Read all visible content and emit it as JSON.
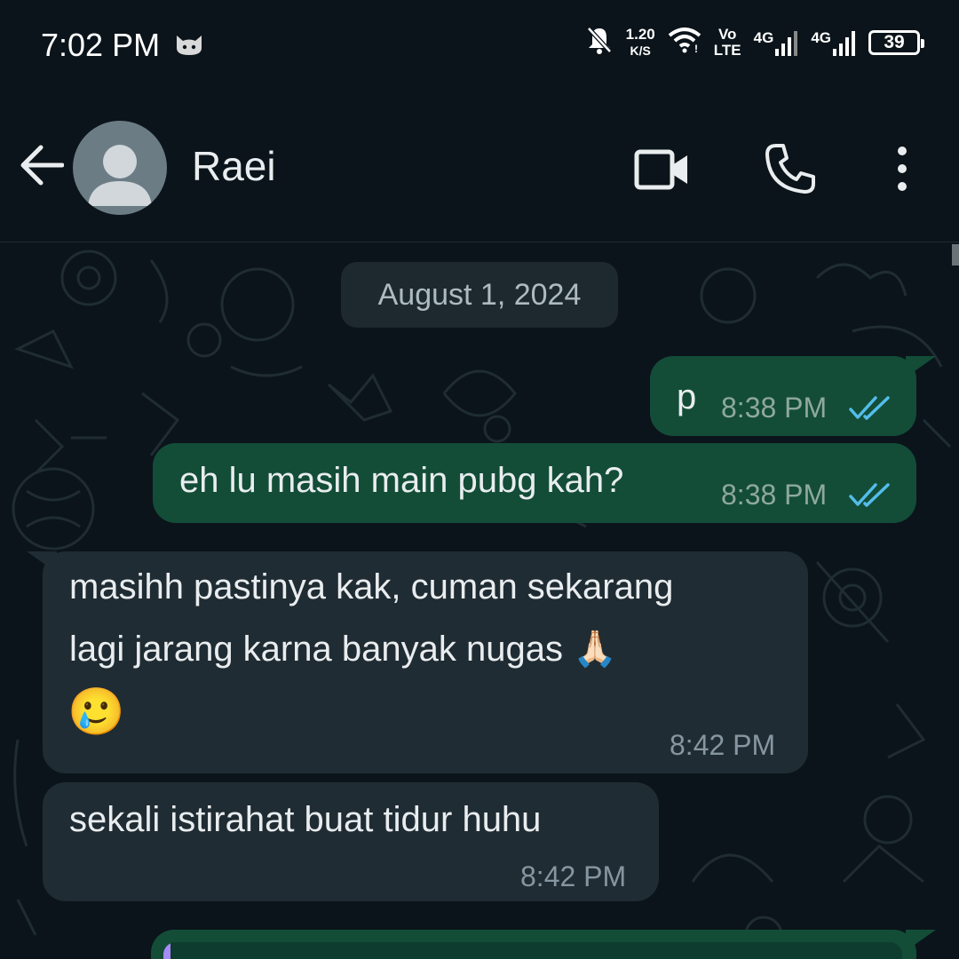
{
  "status_bar": {
    "time": "7:02 PM",
    "speed_value": "1.20",
    "speed_unit": "K/S",
    "volte_top": "Vo",
    "volte_bottom": "LTE",
    "net1": "4G",
    "net2": "4G",
    "battery": "39",
    "icons": [
      "cat-icon",
      "mute-icon",
      "wifi-icon",
      "signal-icon",
      "battery-icon"
    ]
  },
  "header": {
    "contact_name": "Raei",
    "icons": [
      "back-arrow-icon",
      "avatar-icon",
      "video-call-icon",
      "voice-call-icon",
      "more-options-icon"
    ]
  },
  "chat": {
    "date_chip": "August 1, 2024",
    "messages": [
      {
        "direction": "outgoing",
        "text": "p",
        "time": "8:38 PM",
        "status": "read"
      },
      {
        "direction": "outgoing",
        "text": "eh lu masih main pubg kah?",
        "time": "8:38 PM",
        "status": "read"
      },
      {
        "direction": "incoming",
        "line1": "masihh pastinya kak, cuman sekarang",
        "line2": "lagi jarang karna banyak nugas 🙏🏻",
        "line3": "🥲",
        "time": "8:42 PM"
      },
      {
        "direction": "incoming",
        "text": "sekali istirahat buat tidur huhu",
        "time": "8:42 PM"
      }
    ]
  },
  "colors": {
    "background": "#0b141a",
    "outgoing_bubble": "#134d37",
    "incoming_bubble": "#202c33",
    "read_ticks": "#53bdeb",
    "text": "#e9edef"
  }
}
